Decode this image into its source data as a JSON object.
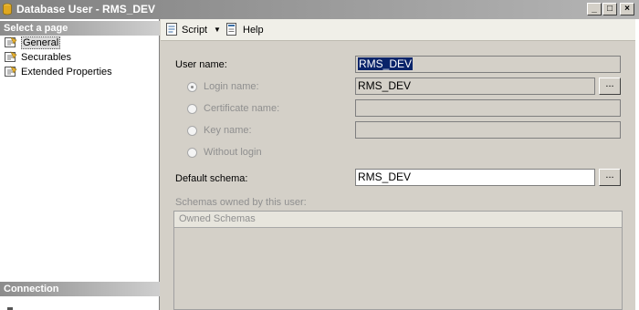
{
  "window": {
    "title": "Database User - RMS_DEV",
    "buttons": [
      "_",
      "□",
      "×"
    ]
  },
  "sidebar": {
    "select_header": "Select a page",
    "items": [
      {
        "label": "General",
        "icon": "page-icon",
        "selected": true
      },
      {
        "label": "Securables",
        "icon": "page-icon",
        "selected": false
      },
      {
        "label": "Extended Properties",
        "icon": "page-icon",
        "selected": false
      }
    ],
    "connection_header": "Connection"
  },
  "toolbar": {
    "script_label": "Script",
    "help_label": "Help"
  },
  "form": {
    "user_name_label": "User name:",
    "user_name_value": "RMS_DEV",
    "login_name_label": "Login name:",
    "login_name_value": "RMS_DEV",
    "certificate_name_label": "Certificate name:",
    "certificate_name_value": "",
    "key_name_label": "Key name:",
    "key_name_value": "",
    "without_login_label": "Without login",
    "default_schema_label": "Default schema:",
    "default_schema_value": "RMS_DEV",
    "ellipsis": "...",
    "schemas_owned_label": "Schemas owned by this user:",
    "owned_schemas_header": "Owned Schemas"
  },
  "colors": {
    "selection": "#0a246a",
    "window_bg": "#d4d0c8"
  }
}
